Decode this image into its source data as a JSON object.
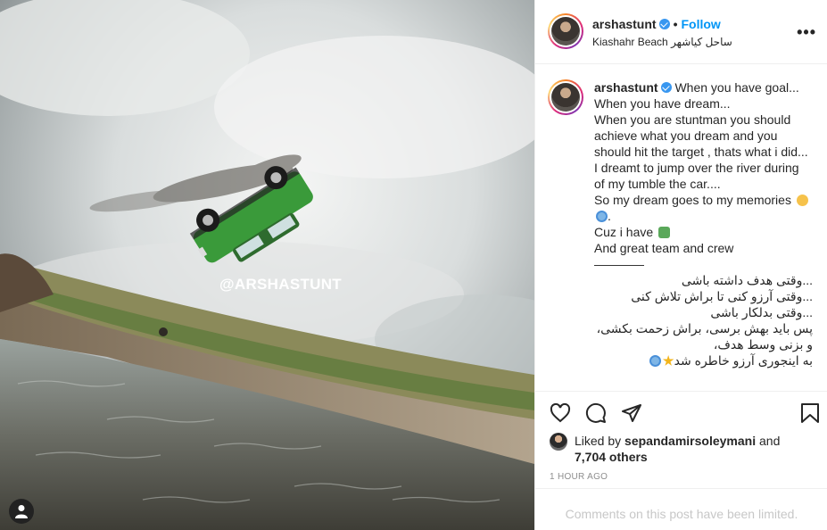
{
  "photo": {
    "watermark": "@ARSHASTUNT",
    "user_tag_icon": "user-tag-icon"
  },
  "header": {
    "username": "arshastunt",
    "verified": true,
    "separator": "•",
    "follow_label": "Follow",
    "location": "Kiashahr Beach ساحل کیاشهر",
    "more_icon": "more-options-icon"
  },
  "caption": {
    "username": "arshastunt",
    "lines": [
      "When you have goal...",
      "When you have dream...",
      "When you are stuntman you should achieve what you dream and you should hit the target , thats what i did...",
      "I dreamt to jump over the river during of my tumble the car....",
      "So my dream goes to my memories",
      ".",
      "Cuz i have",
      "And great team and crew",
      "————",
      "...وقتی هدف داشته باشی",
      "...وقتی آرزو کنی تا براش تلاش کنی",
      "...وقتی بدلکار باشی",
      "پس باید بهش برسی، براش زحمت بکشی، و بزنی وسط هدف،",
      "به اینجوری آرزو خاطره شد"
    ]
  },
  "actions": {
    "like_icon": "heart-icon",
    "comment_icon": "comment-icon",
    "share_icon": "share-icon",
    "save_icon": "bookmark-icon"
  },
  "likes": {
    "prefix": "Liked by ",
    "liked_by_user": "sepandamirsoleymani",
    "connector": " and",
    "others": "7,704 others"
  },
  "timestamp": "1 HOUR AGO",
  "comments_limited": "Comments on this post have been limited.",
  "colors": {
    "accent": "#0095f6",
    "car_green": "#3a9a3a",
    "verified_blue": "#3897f0"
  }
}
